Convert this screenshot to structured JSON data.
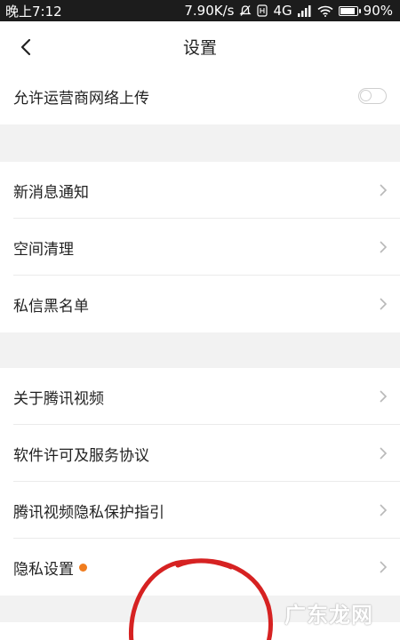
{
  "status_bar": {
    "time": "晚上7:12",
    "net_speed": "7.90K/s",
    "network": "4G",
    "battery": "90%",
    "battery_level": 0.9
  },
  "header": {
    "title": "设置"
  },
  "settings": {
    "upload_toggle": {
      "label": "允许运营商网络上传",
      "enabled": false
    },
    "group_general": [
      {
        "label": "新消息通知"
      },
      {
        "label": "空间清理"
      },
      {
        "label": "私信黑名单"
      }
    ],
    "group_about": [
      {
        "label": "关于腾讯视频"
      },
      {
        "label": "软件许可及服务协议"
      },
      {
        "label": "腾讯视频隐私保护指引"
      },
      {
        "label": "隐私设置",
        "badge": "dot"
      }
    ]
  },
  "watermark": "广东龙网",
  "colors": {
    "badge": "#f07c1e",
    "annotation": "#d62222",
    "status_bar_bg": "#1c1c1c"
  }
}
